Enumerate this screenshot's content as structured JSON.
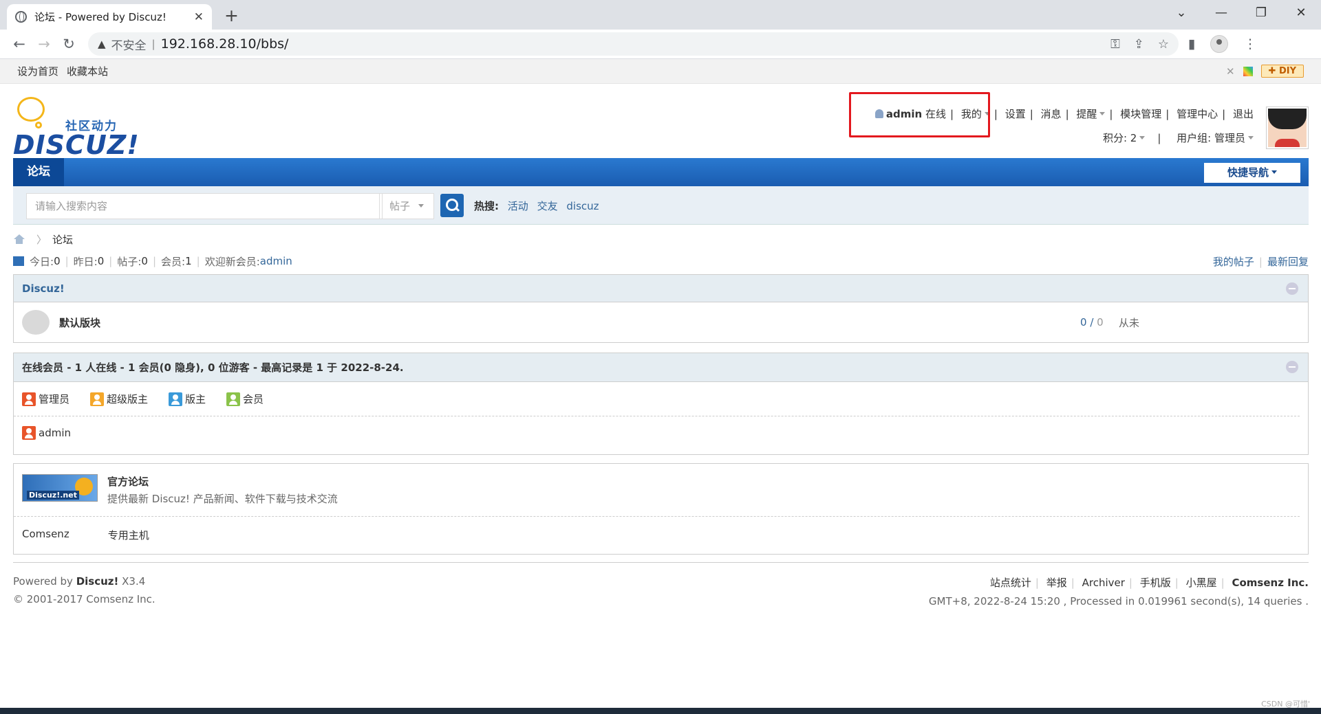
{
  "browser": {
    "tab_title": "论坛 - Powered by Discuz!",
    "tab_close": "✕",
    "new_tab": "+",
    "insecure_label": "不安全",
    "url": "192.168.28.10/bbs/"
  },
  "toptb": {
    "set_home": "设为首页",
    "favorite": "收藏本站",
    "diy": "✚ DIY"
  },
  "logo": {
    "slogan": "社区动力",
    "brand": "DISCUZ!"
  },
  "user": {
    "name": "admin",
    "status": "在线",
    "mine": "我的",
    "settings": "设置",
    "messages": "消息",
    "reminders": "提醒",
    "block_admin": "模块管理",
    "admin_center": "管理中心",
    "logout": "退出",
    "credits": "积分: 2",
    "group": "用户组: 管理员"
  },
  "nav": {
    "current": "论坛",
    "quick_nav": "快捷导航"
  },
  "search": {
    "placeholder": "请输入搜索内容",
    "type": "帖子",
    "hot_label": "热搜:",
    "hot": [
      "活动",
      "交友",
      "discuz"
    ]
  },
  "breadcrumb": {
    "current": "论坛"
  },
  "stats": {
    "today": "今日: ",
    "today_v": "0",
    "yesterday": "昨日: ",
    "yesterday_v": "0",
    "posts": "帖子: ",
    "posts_v": "0",
    "members": "会员: ",
    "members_v": "1",
    "welcome": "欢迎新会员: ",
    "newest": "admin",
    "my_posts": "我的帖子",
    "latest": "最新回复"
  },
  "category": {
    "name": "Discuz!",
    "forum_name": "默认版块",
    "threads": "0",
    "posts": "0",
    "last_post": "从未"
  },
  "online": {
    "title": "在线会员 - 1 人在线 - 1 会员(0 隐身), 0 位游客 - 最高记录是 1 于 2022-8-24.",
    "groups": [
      "管理员",
      "超级版主",
      "版主",
      "会员"
    ],
    "users": [
      "admin"
    ]
  },
  "links": {
    "img_label": "Discuz!.net",
    "title": "官方论坛",
    "desc": "提供最新 Discuz! 产品新闻、软件下载与技术交流",
    "text_links": [
      "Comsenz",
      "专用主机"
    ]
  },
  "footer": {
    "powered": "Powered by ",
    "powered_brand": "Discuz!",
    "version": " X3.4",
    "copyright": "© 2001-2017 Comsenz Inc.",
    "links": [
      "站点统计",
      "举报",
      "Archiver",
      "手机版",
      "小黑屋"
    ],
    "company": "Comsenz Inc.",
    "processed": "GMT+8, 2022-8-24 15:20 , Processed in 0.019961 second(s), 14 queries ."
  },
  "watermark": "CSDN @可惜'"
}
